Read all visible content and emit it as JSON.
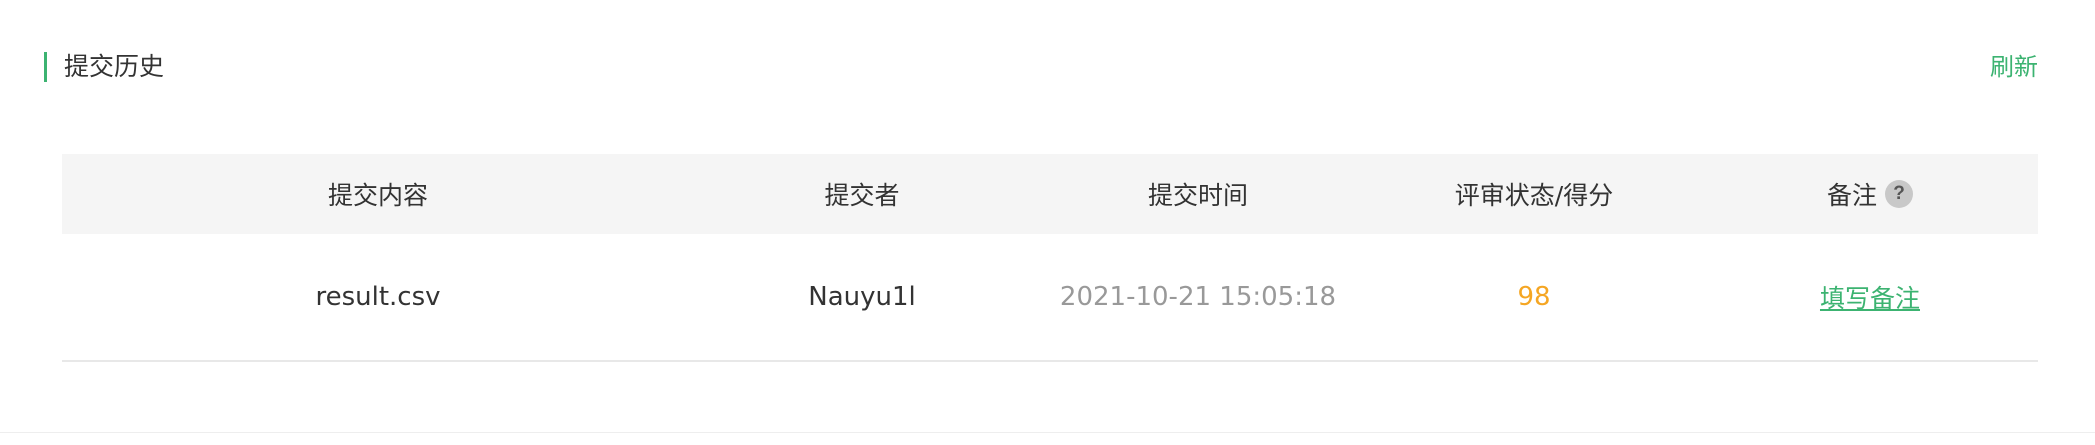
{
  "section": {
    "title": "提交历史",
    "refresh_label": "刷新",
    "accent_color": "#3cb371"
  },
  "table": {
    "headers": [
      "提交内容",
      "提交者",
      "提交时间",
      "评审状态/得分",
      "备注"
    ],
    "notes_help_icon": "question-mark-icon",
    "notes_help_glyph": "?",
    "rows": [
      {
        "content": "result.csv",
        "submitter": "Nauyu1l",
        "time": "2021-10-21 15:05:18",
        "score": "98",
        "notes_link": "填写备注"
      }
    ]
  },
  "colors": {
    "score": "#f5a623",
    "link": "#3cb371",
    "time": "#999999",
    "header_bg": "#f5f5f5"
  }
}
